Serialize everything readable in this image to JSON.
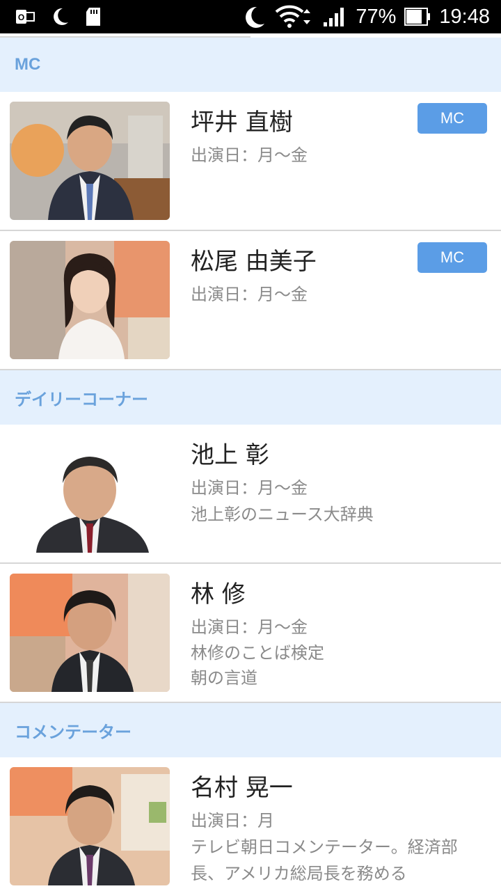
{
  "status_bar": {
    "battery": "77%",
    "time": "19:48",
    "left_icons": [
      "outlook-icon",
      "moon-icon",
      "sd-card-icon"
    ],
    "right_icons": [
      "moon-icon",
      "wifi-icon",
      "signal-icon",
      "battery-icon"
    ]
  },
  "sections": [
    {
      "title": "MC",
      "people": [
        {
          "name": "坪井 直樹",
          "days": "出演日：月〜金",
          "badge": "MC",
          "notes": []
        },
        {
          "name": "松尾 由美子",
          "days": "出演日：月〜金",
          "badge": "MC",
          "notes": []
        }
      ]
    },
    {
      "title": "デイリーコーナー",
      "people": [
        {
          "name": "池上 彰",
          "days": "出演日：月〜金",
          "notes": [
            "池上彰のニュース大辞典"
          ]
        },
        {
          "name": "林 修",
          "days": "出演日：月〜金",
          "notes": [
            "林修のことば検定",
            "朝の言道"
          ]
        }
      ]
    },
    {
      "title": "コメンテーター",
      "people": [
        {
          "name": "名村 晃一",
          "days": "出演日：月",
          "notes": [
            "テレビ朝日コメンテーター。経済部長、アメリカ総局長を務める"
          ]
        }
      ]
    }
  ],
  "colors": {
    "section_bg": "#e4f0fd",
    "section_text": "#6aa2dc",
    "badge_bg": "#5b9de6",
    "divider": "#d6d6d6"
  }
}
